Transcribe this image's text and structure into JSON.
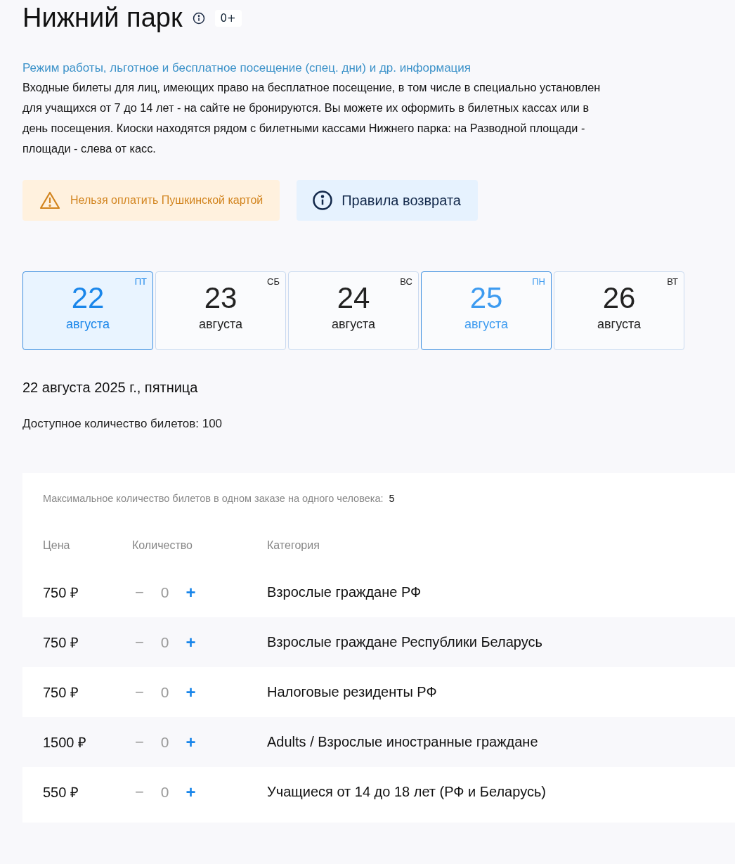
{
  "title": "Нижний парк",
  "age_badge": "0+",
  "info_link": "Режим работы, льготное и бесплатное посещение (спец. дни) и др. информация",
  "info_lines": [
    "Входные билеты для лиц, имеющих право на бесплатное посещение, в том числе в специально установлен",
    "для учащихся от 7 до 14 лет - на сайте не бронируются. Вы можете их оформить в билетных кассах или в",
    "день посещения. Киоски находятся рядом с билетными кассами Нижнего парка: на Разводной площади -",
    "площади - слева от касс."
  ],
  "warning": "Нельзя оплатить Пушкинской картой",
  "refund_button": "Правила возврата",
  "dates": [
    {
      "day": "22",
      "month": "августа",
      "weekday": "ПТ",
      "selected": true,
      "accent": true
    },
    {
      "day": "23",
      "month": "августа",
      "weekday": "СБ",
      "selected": false,
      "accent": false
    },
    {
      "day": "24",
      "month": "августа",
      "weekday": "ВС",
      "selected": false,
      "accent": false
    },
    {
      "day": "25",
      "month": "августа",
      "weekday": "ПН",
      "selected": false,
      "accent": true
    },
    {
      "day": "26",
      "month": "августа",
      "weekday": "ВТ",
      "selected": false,
      "accent": false
    }
  ],
  "selected_date": "22 августа 2025 г., пятница",
  "available": "Доступное количество билетов: 100",
  "tickets": {
    "limit_label": "Максимальное количество билетов в одном заказе на одного человека:",
    "limit_value": "5",
    "columns": [
      "Цена",
      "Количество",
      "Категория"
    ],
    "minus": "−",
    "plus": "+",
    "rows": [
      {
        "price": "750 ₽",
        "count": "0",
        "category": "Взрослые граждане РФ"
      },
      {
        "price": "750 ₽",
        "count": "0",
        "category": "Взрослые граждане Республики Беларусь"
      },
      {
        "price": "750 ₽",
        "count": "0",
        "category": "Налоговые резиденты РФ"
      },
      {
        "price": "1500 ₽",
        "count": "0",
        "category": "Adults / Взрослые иностранные граждане"
      },
      {
        "price": "550 ₽",
        "count": "0",
        "category": "Учащиеся от 14 до 18 лет (РФ и Беларусь)"
      }
    ]
  }
}
